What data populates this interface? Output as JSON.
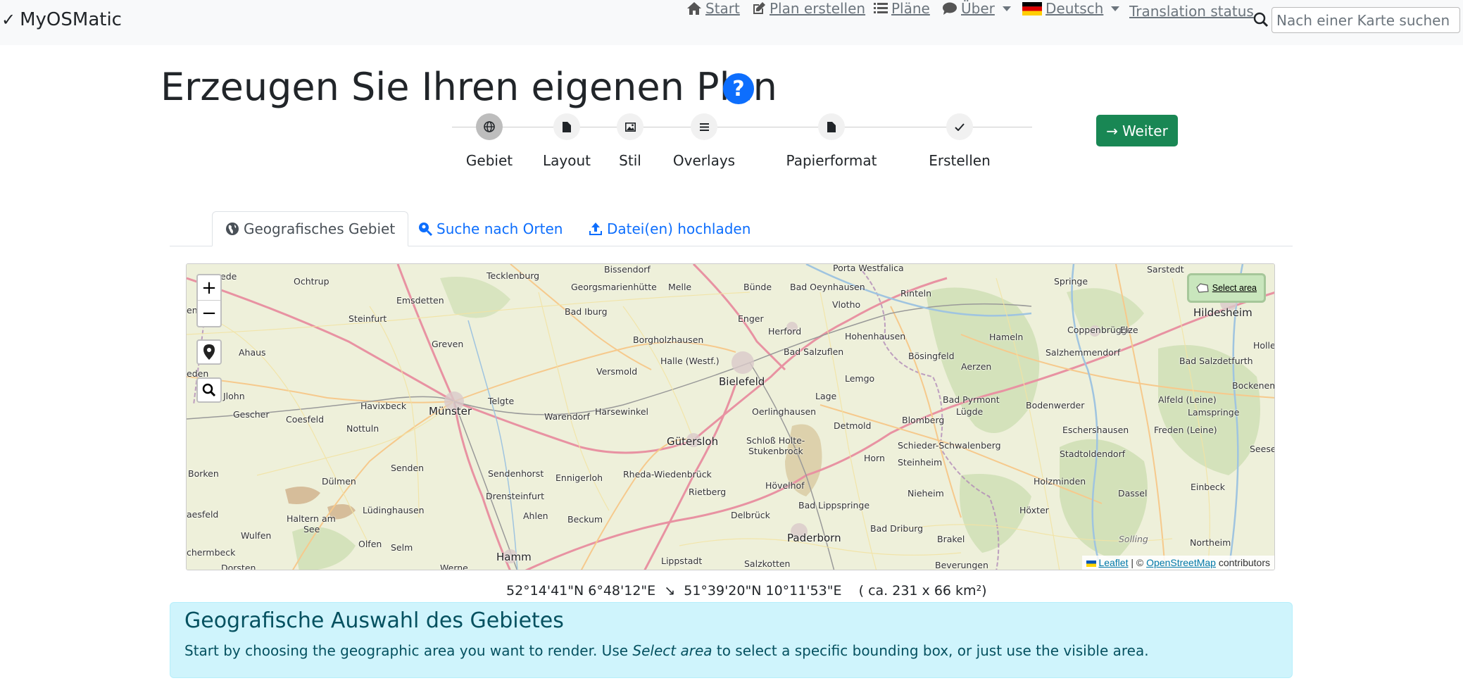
{
  "navbar": {
    "brand": "MyOSMatic",
    "links": {
      "start": "Start",
      "create": "Plan erstellen",
      "plans": "Pläne",
      "about": "Über",
      "language": "Deutsch",
      "translation": "Translation status"
    },
    "search_placeholder": "Nach einer Karte suchen"
  },
  "page": {
    "title": "Erzeugen Sie Ihren eigenen Plan",
    "help": "?"
  },
  "stepper": {
    "steps": [
      "Gebiet",
      "Layout",
      "Stil",
      "Overlays",
      "Papierformat",
      "Erstellen"
    ],
    "active_index": 0,
    "next_label": "Weiter"
  },
  "tabs": {
    "area": "Geografisches Gebiet",
    "search": "Suche nach Orten",
    "upload": "Datei(en) hochladen"
  },
  "map": {
    "zoom_in": "+",
    "zoom_out": "−",
    "select_area": "Select area",
    "attribution_leaflet": "Leaflet",
    "attribution_sep": "| ©",
    "attribution_osm": "OpenStreetMap",
    "attribution_contrib": "contributors",
    "places": {
      "emsdetten": "Emsdetten",
      "ochtrup": "Ochtrup",
      "tecklenburg": "Tecklenburg",
      "bissendorf": "Bissendorf",
      "porta": "Porta Westfalica",
      "sarstedt": "Sarstedt",
      "springe": "Springe",
      "georgsm": "Georgsmarienhütte",
      "melle": "Melle",
      "buende": "Bünde",
      "badoeyn": "Bad Oeynhausen",
      "rinteln": "Rinteln",
      "hildesheim": "Hildesheim",
      "steinfurt": "Steinfurt",
      "badiburg": "Bad Iburg",
      "enger": "Enger",
      "vlotho": "Vlotho",
      "herford": "Herford",
      "hohenhausen": "Hohenhausen",
      "hameln": "Hameln",
      "coppenbruegge": "Coppenbrügge",
      "elze": "Elze",
      "ahaus": "Ahaus",
      "greven": "Greven",
      "borgholz": "Borgholzhausen",
      "badsalzuflen": "Bad Salzuflen",
      "boesingfeld": "Bösingfeld",
      "salzhemmen": "Salzhemmendorf",
      "halle": "Halle (Westf.)",
      "aerzen": "Aerzen",
      "badsalzdet": "Bad Salzdetfurth",
      "versmold": "Versmold",
      "bielefeld": "Bielefeld",
      "lemgo": "Lemgo",
      "bockenem": "Bockenem",
      "telgte": "Telgte",
      "lage": "Lage",
      "badpyrmont": "Bad Pyrmont",
      "alfeld": "Alfeld (Leine)",
      "havixbeck": "Havixbeck",
      "muenster": "Münster",
      "harsewinkel": "Harsewinkel",
      "oerlinghausen": "Oerlinghausen",
      "luegde": "Lügde",
      "bodenwerder": "Bodenwerder",
      "lamspringe": "Lamspringe",
      "gescher": "Gescher",
      "coesfeld": "Coesfeld",
      "nottuln": "Nottuln",
      "warendorf": "Warendorf",
      "detmold": "Detmold",
      "blomberg": "Blomberg",
      "eschershausen": "Eschershausen",
      "freden": "Freden (Leine)",
      "guetersloh": "Gütersloh",
      "schlossholte": "Schloß Holte-",
      "stukenbrock": "Stukenbrock",
      "schieder": "Schieder-Schwalenberg",
      "stadtoldendorf": "Stadtoldendorf",
      "horn": "Horn",
      "steinheim": "Steinheim",
      "senden": "Senden",
      "sendenhorst": "Sendenhorst",
      "ennigerloh": "Ennigerloh",
      "rheda": "Rheda-Wiedenbrück",
      "borken": "Borken",
      "duelmen": "Dülmen",
      "rietberg": "Rietberg",
      "hoevelhof": "Hövelhof",
      "holzminden": "Holzminden",
      "einbeck": "Einbeck",
      "nieheim": "Nieheim",
      "drensteinfurt": "Drensteinfurt",
      "dassel": "Dassel",
      "luedinghausen": "Lüdinghausen",
      "ahlen": "Ahlen",
      "beckum": "Beckum",
      "delbrueck": "Delbrück",
      "badlipp": "Bad Lippspringe",
      "hoexter": "Höxter",
      "haltern": "Haltern am",
      "see": "See",
      "wulfen": "Wulfen",
      "paderborn": "Paderborn",
      "baddriburg": "Bad Driburg",
      "brakel": "Brakel",
      "solling": "Solling",
      "olfen": "Olfen",
      "selm": "Selm",
      "northeim": "Northeim",
      "hamm": "Hamm",
      "lippstadt": "Lippstadt",
      "salzkotten": "Salzkotten",
      "beverungen": "Beverungen",
      "dorsten": "Dorsten",
      "werne": "Werne",
      "chermbeck": "chermbeck",
      "aesfeld": "aesfeld",
      "johln": "Jlohn",
      "ede": "ede",
      "en": "en",
      "eden": "eden",
      "holle": "Holle",
      "seese": "Seese"
    }
  },
  "coords": "52°14'41\"N 6°48'12\"E  ↘  51°39'20\"N 10°11'53\"E    ( ca. 231 x 66 km²)",
  "info": {
    "title": "Geografische Auswahl des Gebietes",
    "text_before": "Start by choosing the geographic area you want to render. Use ",
    "text_em": "Select area",
    "text_after": " to select a specific bounding box, or just use the visible area."
  }
}
